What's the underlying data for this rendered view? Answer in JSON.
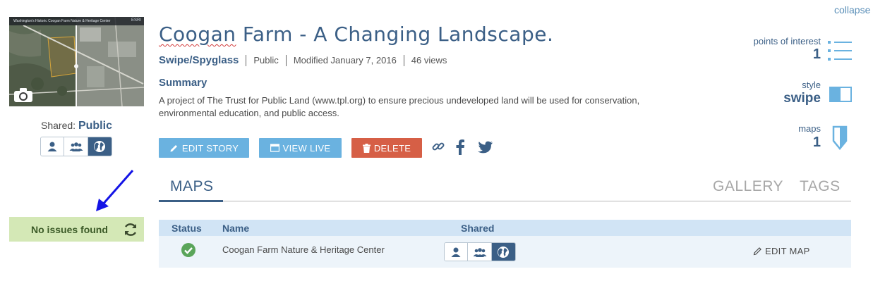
{
  "header": {
    "collapse_label": "collapse"
  },
  "thumbnail": {
    "map_title": "Washington's Historic Coogan Farm Nature & Heritage Center",
    "logo_text": "ESRI"
  },
  "sharing": {
    "label": "Shared:",
    "value": "Public"
  },
  "issues": {
    "label": "No issues found"
  },
  "story": {
    "title_word1": "Coogan",
    "title_rest": " Farm - A Changing Landscape.",
    "type": "Swipe/Spyglass",
    "visibility": "Public",
    "modified": "Modified January 7, 2016",
    "views": "46 views",
    "summary_heading": "Summary",
    "summary_text": "A project of The Trust for Public Land (www.tpl.org) to ensure precious undeveloped land will be used for conservation, environmental education, and public access."
  },
  "actions": {
    "edit_label": "EDIT STORY",
    "view_label": "VIEW LIVE",
    "delete_label": "DELETE"
  },
  "tabs": [
    {
      "label": "MAPS",
      "active": true
    },
    {
      "label": "GALLERY",
      "active": false
    },
    {
      "label": "TAGS",
      "active": false
    }
  ],
  "maps_table": {
    "headers": [
      "Status",
      "Name",
      "Shared"
    ],
    "rows": [
      {
        "name": "Coogan Farm Nature & Heritage Center",
        "shared": "Public",
        "action_label": "EDIT MAP"
      }
    ]
  },
  "stats": [
    {
      "label": "points of interest",
      "value": "1",
      "icon": "list-icon"
    },
    {
      "label": "style",
      "value": "swipe",
      "icon": "swipe-icon"
    },
    {
      "label": "maps",
      "value": "1",
      "icon": "map-pin-icon"
    }
  ],
  "colors": {
    "accent": "#3b5f86",
    "button_blue": "#6ab2e0",
    "button_red": "#d65f46",
    "issues_bg": "#d4e8b6",
    "table_header_bg": "#d1e4f5",
    "status_ok": "#5aa55a"
  }
}
